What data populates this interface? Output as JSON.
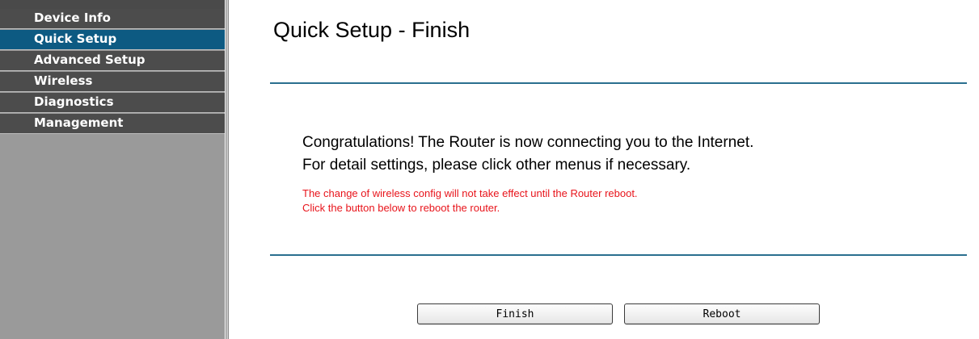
{
  "sidebar": {
    "items": [
      {
        "label": "Device Info",
        "active": false
      },
      {
        "label": "Quick Setup",
        "active": true
      },
      {
        "label": "Advanced Setup",
        "active": false
      },
      {
        "label": "Wireless",
        "active": false
      },
      {
        "label": "Diagnostics",
        "active": false
      },
      {
        "label": "Management",
        "active": false
      }
    ],
    "colors": {
      "item_bg": "#4c4c4c",
      "active_bg": "#0d5a82",
      "panel_bg": "#9a9a9a"
    }
  },
  "main": {
    "title": "Quick Setup - Finish",
    "message_line1": "Congratulations! The Router is now connecting you to the Internet.",
    "message_line2": "For detail settings, please click other menus if necessary.",
    "warning_line1": "The change of wireless config will not take effect until the Router reboot.",
    "warning_line2": "Click the button below to reboot the router.",
    "colors": {
      "warning": "#e8141b",
      "divider": "#2a6f8f"
    }
  },
  "buttons": {
    "finish_label": "Finish",
    "reboot_label": "Reboot"
  }
}
